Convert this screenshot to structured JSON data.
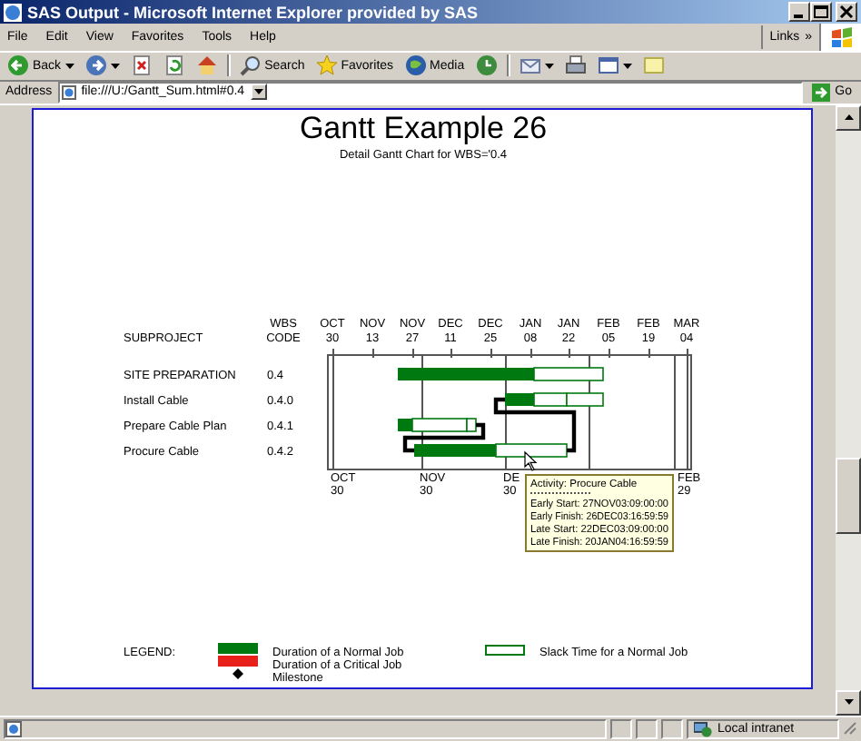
{
  "window": {
    "title": "SAS Output - Microsoft Internet Explorer provided by SAS"
  },
  "menu": [
    "File",
    "Edit",
    "View",
    "Favorites",
    "Tools",
    "Help"
  ],
  "links": {
    "label": "Links",
    "chevron": "»"
  },
  "toolbar": [
    {
      "kind": "back",
      "label": "Back"
    },
    {
      "kind": "forward"
    },
    {
      "kind": "stop"
    },
    {
      "kind": "refresh"
    },
    {
      "kind": "home"
    },
    {
      "kind": "search",
      "label": "Search"
    },
    {
      "kind": "favorites",
      "label": "Favorites"
    },
    {
      "kind": "media",
      "label": "Media"
    },
    {
      "kind": "history"
    },
    {
      "kind": "mail"
    },
    {
      "kind": "print"
    },
    {
      "kind": "edit"
    },
    {
      "kind": "discuss"
    }
  ],
  "address": {
    "label": "Address",
    "value": "file:///U:/Gantt_Sum.html#0.4",
    "go": "Go"
  },
  "report": {
    "title": "Gantt Example 26",
    "subtitle": "Detail Gantt Chart for WBS='0.4",
    "headers": {
      "subproject": "SUBPROJECT",
      "wbs": "WBS",
      "code": "CODE"
    },
    "top_ticks": [
      {
        "month": "OCT",
        "day": "30"
      },
      {
        "month": "NOV",
        "day": "13"
      },
      {
        "month": "NOV",
        "day": "27"
      },
      {
        "month": "DEC",
        "day": "11"
      },
      {
        "month": "DEC",
        "day": "25"
      },
      {
        "month": "JAN",
        "day": "08"
      },
      {
        "month": "JAN",
        "day": "22"
      },
      {
        "month": "FEB",
        "day": "05"
      },
      {
        "month": "FEB",
        "day": "19"
      },
      {
        "month": "MAR",
        "day": "04"
      }
    ],
    "bottom_ticks": [
      {
        "month": "OCT",
        "day": "30"
      },
      {
        "month": "NOV",
        "day": "30"
      },
      {
        "month": "DE",
        "day": "30"
      },
      {
        "month": "FEB",
        "day": "29"
      }
    ],
    "tasks": [
      {
        "name": "SITE PREPARATION",
        "code": "0.4"
      },
      {
        "name": "Install Cable",
        "code": "0.4.0"
      },
      {
        "name": "Prepare Cable Plan",
        "code": "0.4.1"
      },
      {
        "name": "Procure Cable",
        "code": "0.4.2"
      }
    ],
    "tooltip": {
      "activity": "Activity: Procure Cable",
      "lines": [
        "Early Start: 27NOV03:09:00:00",
        "Early Finish: 26DEC03:16:59:59",
        "Late Start: 22DEC03:09:00:00",
        "Late Finish: 20JAN04:16:59:59"
      ]
    },
    "legend": {
      "label": "LEGEND:",
      "items": [
        {
          "kind": "normal",
          "label": "Duration of a Normal Job"
        },
        {
          "kind": "critical",
          "label": "Duration of a Critical Job"
        },
        {
          "kind": "milestone",
          "label": "Milestone"
        },
        {
          "kind": "slack",
          "label": "Slack Time for a Normal Job"
        }
      ]
    }
  },
  "status": {
    "zone": "Local intranet"
  }
}
